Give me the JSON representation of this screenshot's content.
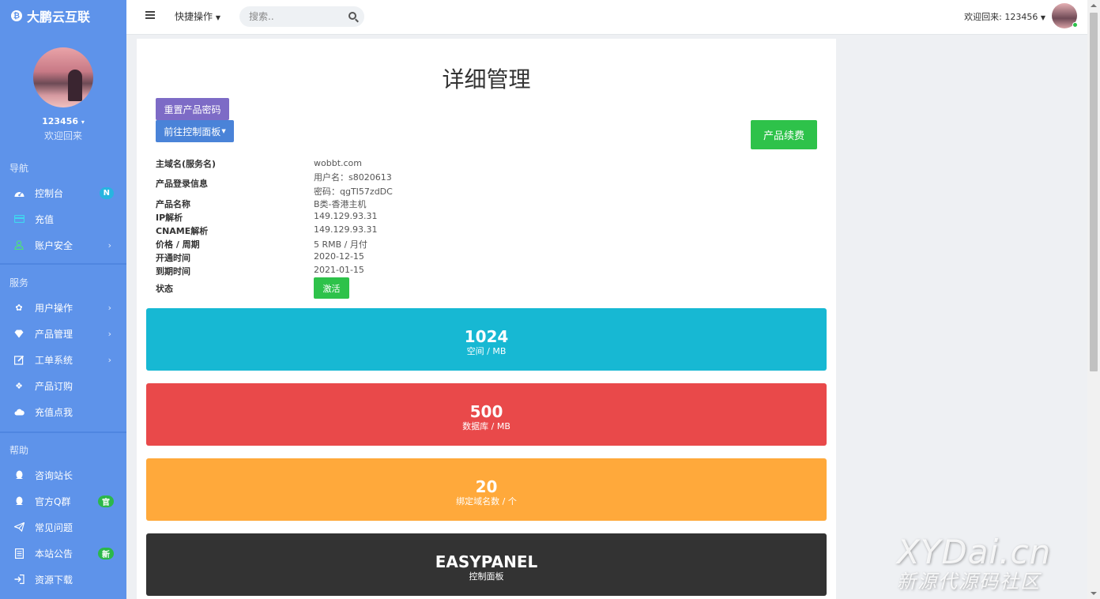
{
  "brand": {
    "name": "大鹏云互联"
  },
  "user": {
    "name": "123456",
    "welcome": "欢迎回来"
  },
  "sidebar": {
    "sections": [
      {
        "label": "导航"
      },
      {
        "label": "服务"
      },
      {
        "label": "帮助"
      }
    ],
    "items": [
      {
        "label": "控制台",
        "icon": "dashboard-icon",
        "badge": "N"
      },
      {
        "label": "充值",
        "icon": "card-icon"
      },
      {
        "label": "账户安全",
        "icon": "user-icon"
      },
      {
        "label": "用户操作",
        "icon": "gear-icon"
      },
      {
        "label": "产品管理",
        "icon": "diamond-icon"
      },
      {
        "label": "工单系统",
        "icon": "edit-icon"
      },
      {
        "label": "产品订购",
        "icon": "cube-icon"
      },
      {
        "label": "充值点我",
        "icon": "cloud-icon"
      },
      {
        "label": "咨询站长",
        "icon": "qq-icon"
      },
      {
        "label": "官方Q群",
        "icon": "qq-icon",
        "badge": "官"
      },
      {
        "label": "常见问题",
        "icon": "paper-plane-icon"
      },
      {
        "label": "本站公告",
        "icon": "document-icon",
        "badge": "新"
      },
      {
        "label": "资源下载",
        "icon": "sign-in-icon"
      }
    ]
  },
  "topbar": {
    "quick_ops": "快捷操作",
    "search_placeholder": "搜索..",
    "welcome": "欢迎回来: 123456"
  },
  "page": {
    "title": "详细管理",
    "btn_reset": "重置产品密码",
    "btn_panel": "前往控制面板",
    "btn_renew": "产品续费",
    "info": {
      "domain_label": "主域名(服务名)",
      "domain": "wobbt.com",
      "login_label": "产品登录信息",
      "login_user": "用户名：s8020613",
      "login_pass": "密码：qgTI57zdDC",
      "name_label": "产品名称",
      "name": "B类-香港主机",
      "ip_label": "IP解析",
      "ip": "149.129.93.31",
      "cname_label": "CNAME解析",
      "cname": "149.129.93.31",
      "price_label": "价格 / 周期",
      "price": "5 RMB / 月付",
      "open_label": "开通时间",
      "open": "2020-12-15",
      "expire_label": "到期时间",
      "expire": "2021-01-15",
      "status_label": "状态",
      "status": "激活"
    },
    "stats": [
      {
        "value": "1024",
        "label": "空间 / MB",
        "color": "#17b8d3"
      },
      {
        "value": "500",
        "label": "数据库 / MB",
        "color": "#e9494a"
      },
      {
        "value": "20",
        "label": "绑定域名数 / 个",
        "color": "#ffa93b"
      },
      {
        "value": "EASYPANEL",
        "label": "控制面板",
        "color": "#333333"
      }
    ]
  },
  "watermark": {
    "line1": "XYDai.cn",
    "line2": "新源代源码社区"
  }
}
